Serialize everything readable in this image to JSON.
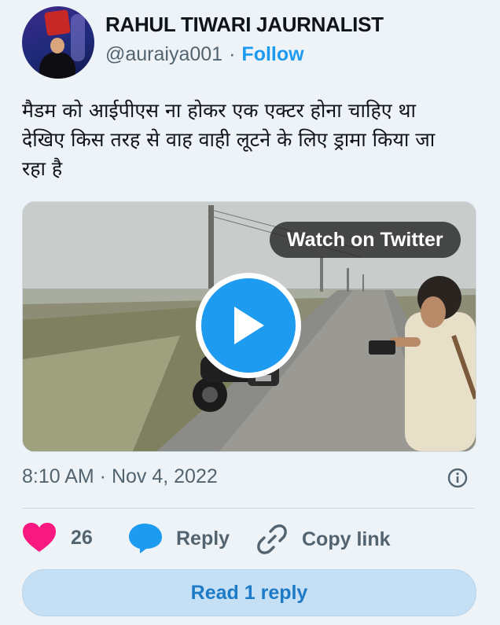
{
  "author": {
    "display_name": "RAHUL TIWARI JAURNALIST",
    "handle": "@auraiya001",
    "separator": "·",
    "follow_label": "Follow"
  },
  "tweet": {
    "text_lines": [
      "मैडम को आईपीएस ना होकर एक एक्टर होना चाहिए था",
      "देखिए किस तरह से वाह वाही लूटने के लिए ड्रामा किया जा",
      "रहा है"
    ],
    "timestamp": "8:10 AM · Nov 4, 2022"
  },
  "media": {
    "watch_label": "Watch on Twitter",
    "play_icon": "play-icon"
  },
  "actions": {
    "like_count": "26",
    "reply_label": "Reply",
    "copy_label": "Copy link",
    "read_reply_label": "Read 1 reply"
  },
  "colors": {
    "accent": "#1d9bf0",
    "like": "#f91880",
    "secondary_text": "#536471"
  }
}
